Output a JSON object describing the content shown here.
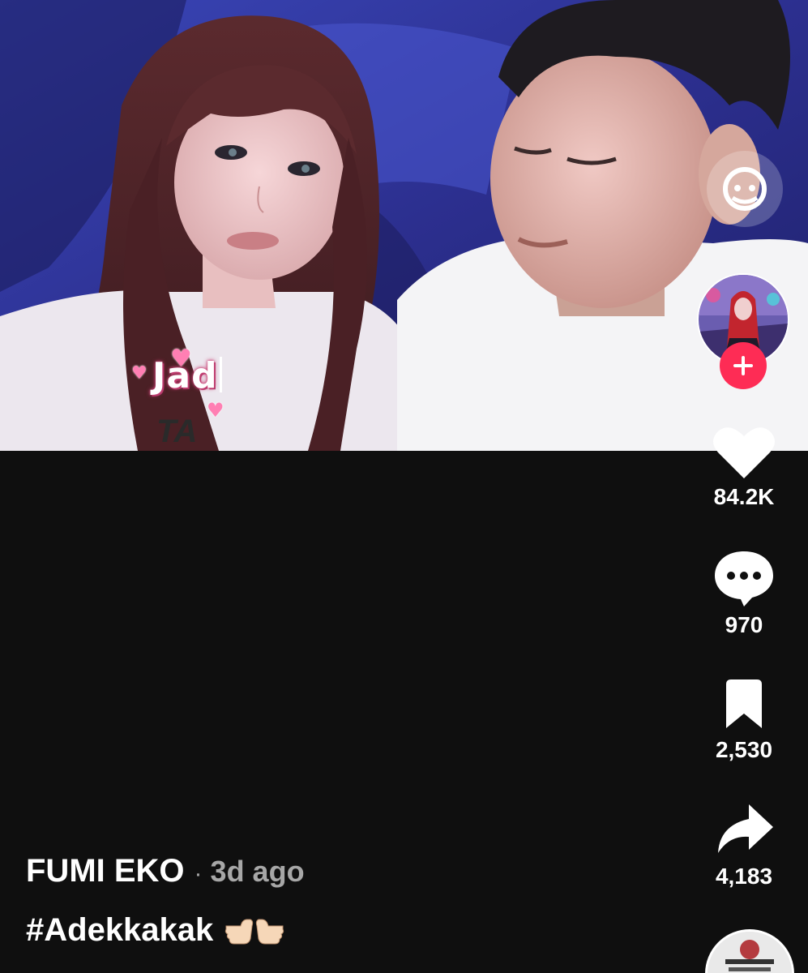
{
  "video": {
    "overlay_caption": "Jad",
    "shirt_text": "TA"
  },
  "rail": {
    "live_icon": "live-face-icon",
    "follow_icon": "plus-icon",
    "like": {
      "icon": "heart-icon",
      "count": "84.2K"
    },
    "comment": {
      "icon": "comment-bubble-icon",
      "count": "970"
    },
    "save": {
      "icon": "bookmark-icon",
      "count": "2,530"
    },
    "share": {
      "icon": "share-arrow-icon",
      "count": "4,183"
    },
    "music_icon": "music-disc-icon"
  },
  "post": {
    "author": "FUMI EKO",
    "separator": "·",
    "age": "3d ago",
    "caption": "#Adekkakak"
  },
  "colors": {
    "follow_red": "#fe2c55",
    "background": "#0f0f0f",
    "muted_text": "#a7a7a7"
  }
}
